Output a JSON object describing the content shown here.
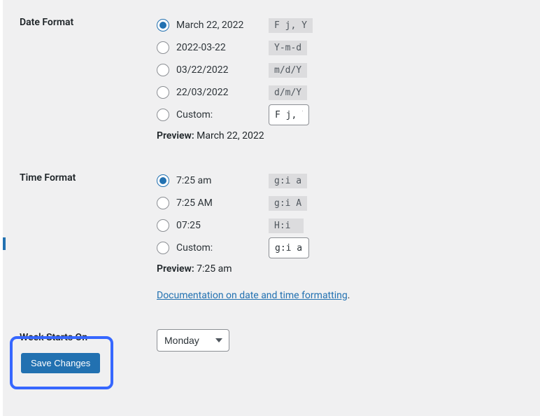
{
  "date_format": {
    "label": "Date Format",
    "options": [
      {
        "text": "March 22, 2022",
        "code": "F j, Y",
        "selected": true
      },
      {
        "text": "2022-03-22",
        "code": "Y-m-d",
        "selected": false
      },
      {
        "text": "03/22/2022",
        "code": "m/d/Y",
        "selected": false
      },
      {
        "text": "22/03/2022",
        "code": "d/m/Y",
        "selected": false
      }
    ],
    "custom_label": "Custom:",
    "custom_value": "F j, Y",
    "preview_label": "Preview:",
    "preview_value": "March 22, 2022"
  },
  "time_format": {
    "label": "Time Format",
    "options": [
      {
        "text": "7:25 am",
        "code": "g:i a",
        "selected": true
      },
      {
        "text": "7:25 AM",
        "code": "g:i A",
        "selected": false
      },
      {
        "text": "07:25",
        "code": "H:i",
        "selected": false
      }
    ],
    "custom_label": "Custom:",
    "custom_value": "g:i a",
    "preview_label": "Preview:",
    "preview_value": "7:25 am"
  },
  "doc_link_text": "Documentation on date and time formatting",
  "week_starts": {
    "label": "Week Starts On",
    "value": "Monday"
  },
  "save_button": "Save Changes"
}
